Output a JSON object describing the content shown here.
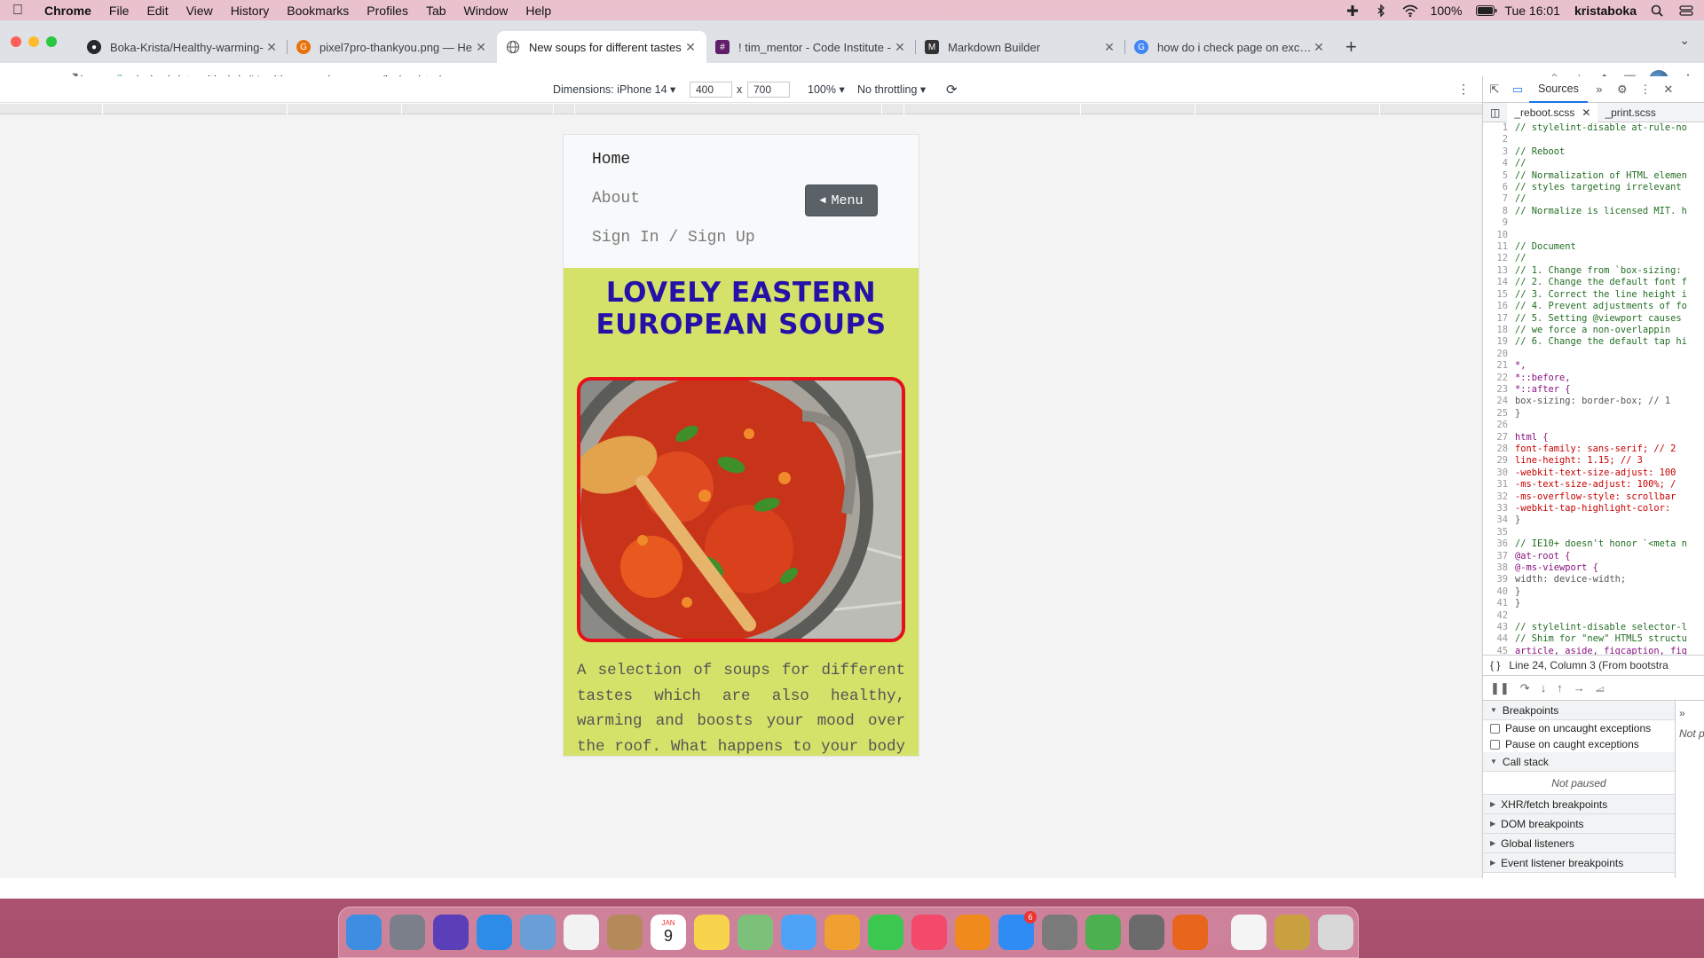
{
  "menubar": {
    "app": "Chrome",
    "items": [
      "File",
      "Edit",
      "View",
      "History",
      "Bookmarks",
      "Profiles",
      "Tab",
      "Window",
      "Help"
    ],
    "battery": "100%",
    "clock": "Tue 16:01",
    "user": "kristaboka"
  },
  "tabs": [
    {
      "title": "Boka-Krista/Healthy-warming-",
      "icon": "github-icon",
      "color": "#24292e"
    },
    {
      "title": "pixel7pro-thankyou.png — He",
      "icon": "google-icon",
      "color": "#e8710a"
    },
    {
      "title": "New soups for different tastes",
      "icon": "globe-icon",
      "color": "#5f6368"
    },
    {
      "title": "! tim_mentor - Code Institute -",
      "icon": "slack-icon",
      "color": "#611f69"
    },
    {
      "title": "Markdown Builder",
      "icon": "markdown-icon",
      "color": "#333333"
    },
    {
      "title": "how do i check page on excel s",
      "icon": "google-icon",
      "color": "#4285f4"
    }
  ],
  "address": {
    "url": "boka-krista.github.io/Healthy-warming-soups/index.html"
  },
  "device_toolbar": {
    "dimensions": "Dimensions: iPhone 14 ▾",
    "width": "400",
    "times": "x",
    "height": "700",
    "zoom": "100% ▾",
    "throttling": "No throttling ▾"
  },
  "page": {
    "nav": {
      "home": "Home",
      "about": "About",
      "signin": "Sign In / Sign Up",
      "menu_button": "Menu"
    },
    "title": "LOVELY EASTERN EUROPEAN SOUPS",
    "intro": "A selection of soups for different tastes which are also healthy, warming and boosts your mood over the roof. What happens to your body when you eat soup?",
    "colors": {
      "background": "#d4e26a",
      "title": "#2511a8",
      "image_border": "#e8111a",
      "menu_button": "#5a6268"
    }
  },
  "devtools": {
    "panel_tab": "Sources",
    "files": [
      "_reboot.scss",
      "_print.scss"
    ],
    "code_lines": [
      {
        "n": "1",
        "t": "// stylelint-disable at-rule-no",
        "k": "cm"
      },
      {
        "n": "2",
        "t": "",
        "k": ""
      },
      {
        "n": "3",
        "t": "// Reboot",
        "k": "cm"
      },
      {
        "n": "4",
        "t": "//",
        "k": "cm"
      },
      {
        "n": "5",
        "t": "// Normalization of HTML elemen",
        "k": "cm"
      },
      {
        "n": "6",
        "t": "// styles targeting irrelevant",
        "k": "cm"
      },
      {
        "n": "7",
        "t": "//",
        "k": "cm"
      },
      {
        "n": "8",
        "t": "// Normalize is licensed MIT. h",
        "k": "cm"
      },
      {
        "n": "9",
        "t": "",
        "k": ""
      },
      {
        "n": "10",
        "t": "",
        "k": ""
      },
      {
        "n": "11",
        "t": "// Document",
        "k": "cm"
      },
      {
        "n": "12",
        "t": "//",
        "k": "cm"
      },
      {
        "n": "13",
        "t": "// 1. Change from `box-sizing:",
        "k": "cm"
      },
      {
        "n": "14",
        "t": "// 2. Change the default font f",
        "k": "cm"
      },
      {
        "n": "15",
        "t": "// 3. Correct the line height i",
        "k": "cm"
      },
      {
        "n": "16",
        "t": "// 4. Prevent adjustments of fo",
        "k": "cm"
      },
      {
        "n": "17",
        "t": "// 5. Setting @viewport causes",
        "k": "cm"
      },
      {
        "n": "18",
        "t": "//    we force a non-overlappin",
        "k": "cm"
      },
      {
        "n": "19",
        "t": "// 6. Change the default tap hi",
        "k": "cm"
      },
      {
        "n": "20",
        "t": "",
        "k": ""
      },
      {
        "n": "21",
        "t": "*,",
        "k": "sel"
      },
      {
        "n": "22",
        "t": "*::before,",
        "k": "sel"
      },
      {
        "n": "23",
        "t": "*::after {",
        "k": "sel"
      },
      {
        "n": "24",
        "t": "  box-sizing: border-box; // 1",
        "k": ""
      },
      {
        "n": "25",
        "t": "}",
        "k": ""
      },
      {
        "n": "26",
        "t": "",
        "k": ""
      },
      {
        "n": "27",
        "t": "html {",
        "k": "sel"
      },
      {
        "n": "28",
        "t": "  font-family: sans-serif; // 2",
        "k": "prop"
      },
      {
        "n": "29",
        "t": "  line-height: 1.15; // 3",
        "k": "prop"
      },
      {
        "n": "30",
        "t": "  -webkit-text-size-adjust: 100",
        "k": "prop"
      },
      {
        "n": "31",
        "t": "  -ms-text-size-adjust: 100%; /",
        "k": "prop"
      },
      {
        "n": "32",
        "t": "  -ms-overflow-style: scrollbar",
        "k": "prop"
      },
      {
        "n": "33",
        "t": "  -webkit-tap-highlight-color:",
        "k": "prop"
      },
      {
        "n": "34",
        "t": "}",
        "k": ""
      },
      {
        "n": "35",
        "t": "",
        "k": ""
      },
      {
        "n": "36",
        "t": "// IE10+ doesn't honor `<meta n",
        "k": "cm"
      },
      {
        "n": "37",
        "t": "@at-root {",
        "k": "sel"
      },
      {
        "n": "38",
        "t": "  @-ms-viewport {",
        "k": "sel"
      },
      {
        "n": "39",
        "t": "    width: device-width;",
        "k": ""
      },
      {
        "n": "40",
        "t": "  }",
        "k": ""
      },
      {
        "n": "41",
        "t": "}",
        "k": ""
      },
      {
        "n": "42",
        "t": "",
        "k": ""
      },
      {
        "n": "43",
        "t": "// stylelint-disable selector-l",
        "k": "cm"
      },
      {
        "n": "44",
        "t": "// Shim for \"new\" HTML5 structu",
        "k": "cm"
      },
      {
        "n": "45",
        "t": "article, aside, figcaption, fig",
        "k": "sel"
      }
    ],
    "cursor_status": "Line 24, Column 3 (From bootstra",
    "breakpoints_label": "Breakpoints",
    "pause_uncaught": "Pause on uncaught exceptions",
    "pause_caught": "Pause on caught exceptions",
    "call_stack_label": "Call stack",
    "not_paused": "Not paused",
    "xhr_label": "XHR/fetch breakpoints",
    "dom_label": "DOM breakpoints",
    "global_label": "Global listeners",
    "event_label": "Event listener breakpoints",
    "side_not_paused": "Not p"
  },
  "dock": {
    "items": [
      {
        "name": "finder-icon",
        "color": "#3d8ee0"
      },
      {
        "name": "launchpad-icon",
        "color": "#7a7f8a"
      },
      {
        "name": "siri-icon",
        "color": "#5b3fb8"
      },
      {
        "name": "safari-icon",
        "color": "#2d8ce8"
      },
      {
        "name": "mail-icon",
        "color": "#6a9ed6"
      },
      {
        "name": "reminders-icon",
        "color": "#f2f2f2"
      },
      {
        "name": "notefile-icon",
        "color": "#b58a5a"
      },
      {
        "name": "calendar-icon",
        "color": "#ffffff"
      },
      {
        "name": "notes-icon",
        "color": "#f7d44c"
      },
      {
        "name": "maps-icon",
        "color": "#7cc17a"
      },
      {
        "name": "messages-icon",
        "color": "#4fa3f7"
      },
      {
        "name": "photos-icon",
        "color": "#f0a030"
      },
      {
        "name": "facetime-icon",
        "color": "#3cc850"
      },
      {
        "name": "music-icon",
        "color": "#f34a6b"
      },
      {
        "name": "books-icon",
        "color": "#f08a1c"
      },
      {
        "name": "appstore-icon",
        "color": "#2f8cf5"
      },
      {
        "name": "system-preferences-icon",
        "color": "#7a7a7a"
      },
      {
        "name": "chrome-icon",
        "color": "#4caf50"
      },
      {
        "name": "xcode-instruments-icon",
        "color": "#6b6b6b"
      },
      {
        "name": "firefox-icon",
        "color": "#e8661c"
      },
      {
        "name": "downloads-stack-icon",
        "color": "#f4f4f4"
      },
      {
        "name": "screenshots-stack-icon",
        "color": "#c8a040"
      },
      {
        "name": "trash-icon",
        "color": "#d8d8d8"
      }
    ],
    "calendar_month": "JAN",
    "calendar_day": "9",
    "appstore_badge": "6"
  }
}
